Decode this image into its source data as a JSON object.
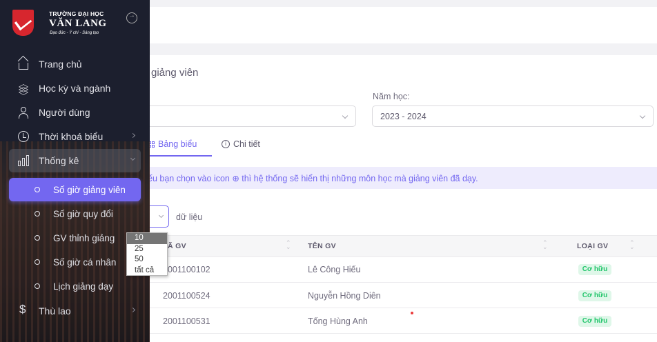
{
  "logo": {
    "line1": "TRƯỜNG ĐẠI HỌC",
    "line2": "VĂN LANG",
    "tagline": "Đạo đức - Ý chí - Sáng tạo"
  },
  "sidebar": {
    "items": [
      {
        "label": "Trang chủ",
        "icon": "home-icon"
      },
      {
        "label": "Học kỳ và ngành",
        "icon": "layers-icon"
      },
      {
        "label": "Người dùng",
        "icon": "user-icon"
      },
      {
        "label": "Thời khoá biểu",
        "icon": "clock-icon"
      },
      {
        "label": "Thống kê",
        "icon": "bar-chart-icon"
      }
    ],
    "sub_items": [
      {
        "label": "Số giờ giảng viên",
        "active": true
      },
      {
        "label": "Số giờ quy đổi"
      },
      {
        "label": "GV thỉnh giảng"
      },
      {
        "label": "Số giờ cá nhân"
      },
      {
        "label": "Lịch giảng dạy"
      }
    ],
    "last_item": {
      "label": "Thù lao",
      "icon": "dollar-icon"
    }
  },
  "main": {
    "title": "ờ giảng viên",
    "year_label": "Năm học:",
    "year_value": "2023 - 2024",
    "tabs": [
      {
        "label": "Bảng biểu",
        "active": true
      },
      {
        "label": "Chi tiết"
      }
    ],
    "notice": "ếu bạn chọn vào icon ⊕ thì hệ thống sẽ hiển thị những môn học mà giảng viên đã dạy.",
    "length_suffix": "dữ liệu",
    "length_options": [
      "10",
      "25",
      "50",
      "tất cả"
    ],
    "length_selected": "10",
    "table": {
      "headers": [
        "Ã GV",
        "TÊN GV",
        "LOẠI GV"
      ],
      "rows": [
        {
          "id": "2001100102",
          "name": "Lê Công Hiếu",
          "type": "Cơ hữu"
        },
        {
          "id": "2001100524",
          "name": "Nguyễn Hồng Diên",
          "type": "Cơ hữu"
        },
        {
          "id": "2001100531",
          "name": "Tống Hùng Anh",
          "type": "Cơ hữu"
        }
      ]
    }
  },
  "colors": {
    "accent": "#7367f0",
    "sidebar": "#1c1f2e",
    "badge_bg": "#dff7e9",
    "badge_text": "#28c76f"
  }
}
